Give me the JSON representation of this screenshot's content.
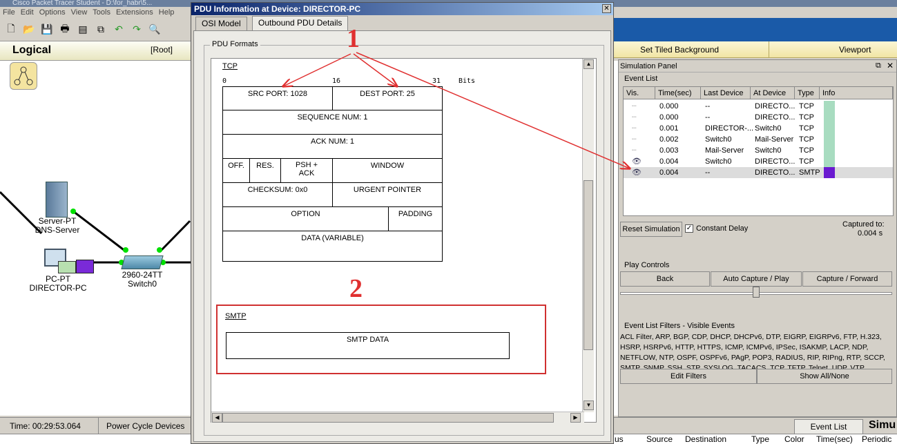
{
  "app": {
    "title": "Cisco Packet Tracer Student - D:\\for_habr\\5...",
    "menu": [
      "File",
      "Edit",
      "Options",
      "View",
      "Tools",
      "Extensions",
      "Help"
    ],
    "logical_label": "Logical",
    "root_label": "[Root]",
    "tiled_label": "Set Tiled Background",
    "viewport_label": "Viewport",
    "time_label": "Time: 00:29:53.064",
    "power_cycle_label": "Power Cycle Devices",
    "event_list_tab": "Event List",
    "simulation_tab": "Simu",
    "bottom_headers": [
      "us",
      "Source",
      "Destination",
      "Type",
      "Color",
      "Time(sec)",
      "Periodic"
    ]
  },
  "devices": {
    "server": {
      "type": "Server-PT",
      "name": "DNS-Server"
    },
    "switch": {
      "type": "2960-24TT",
      "name": "Switch0"
    },
    "pc": {
      "type": "PC-PT",
      "name": "DIRECTOR-PC"
    }
  },
  "dialog": {
    "title": "PDU Information at Device: DIRECTOR-PC",
    "tabs": [
      "OSI Model",
      "Outbound PDU Details"
    ],
    "group_label": "PDU Formats",
    "tcp": {
      "label": "TCP",
      "ruler": [
        "0",
        "16",
        "31",
        "Bits"
      ],
      "src_port": "SRC PORT: 1028",
      "dest_port": "DEST PORT: 25",
      "seq": "SEQUENCE NUM: 1",
      "ack": "ACK NUM: 1",
      "off": "OFF.",
      "res": "RES.",
      "flags": "PSH + ACK",
      "window": "WINDOW",
      "checksum": "CHECKSUM: 0x0",
      "urgent": "URGENT POINTER",
      "option": "OPTION",
      "padding": "PADDING",
      "data": "DATA (VARIABLE)"
    },
    "smtp": {
      "label": "SMTP",
      "data": "SMTP DATA"
    },
    "annotations": {
      "one": "1",
      "two": "2"
    }
  },
  "sim": {
    "title": "Simulation Panel",
    "event_list_label": "Event List",
    "columns": [
      "Vis.",
      "Time(sec)",
      "Last Device",
      "At Device",
      "Type",
      "Info"
    ],
    "events": [
      {
        "time": "0.000",
        "last": "--",
        "at": "DIRECTO...",
        "type": "TCP",
        "color": "#a8dcc0",
        "eye": false,
        "selected": false
      },
      {
        "time": "0.000",
        "last": "--",
        "at": "DIRECTO...",
        "type": "TCP",
        "color": "#a8dcc0",
        "eye": false,
        "selected": false
      },
      {
        "time": "0.001",
        "last": "DIRECTOR-...",
        "at": "Switch0",
        "type": "TCP",
        "color": "#a8dcc0",
        "eye": false,
        "selected": false
      },
      {
        "time": "0.002",
        "last": "Switch0",
        "at": "Mail-Server",
        "type": "TCP",
        "color": "#a8dcc0",
        "eye": false,
        "selected": false
      },
      {
        "time": "0.003",
        "last": "Mail-Server",
        "at": "Switch0",
        "type": "TCP",
        "color": "#a8dcc0",
        "eye": false,
        "selected": false
      },
      {
        "time": "0.004",
        "last": "Switch0",
        "at": "DIRECTO...",
        "type": "TCP",
        "color": "#a8dcc0",
        "eye": true,
        "selected": false
      },
      {
        "time": "0.004",
        "last": "--",
        "at": "DIRECTO...",
        "type": "SMTP",
        "color": "#6a1ad0",
        "eye": true,
        "selected": true
      }
    ],
    "reset_label": "Reset Simulation",
    "constant_delay_label": "Constant Delay",
    "captured_label": "Captured to:",
    "captured_value": "0.004 s",
    "play_controls_label": "Play Controls",
    "back_label": "Back",
    "auto_label": "Auto Capture / Play",
    "capture_label": "Capture / Forward",
    "filters_label": "Event List Filters - Visible Events",
    "filters_text": "ACL Filter, ARP, BGP, CDP, DHCP, DHCPv6, DTP, EIGRP, EIGRPv6, FTP, H.323, HSRP, HSRPv6, HTTP, HTTPS, ICMP, ICMPv6, IPSec, ISAKMP, LACP, NDP, NETFLOW, NTP, OSPF, OSPFv6, PAgP, POP3, RADIUS, RIP, RIPng, RTP, SCCP, SMTP, SNMP, SSH, STP, SYSLOG, TACACS, TCP, TFTP, Telnet, UDP, VTP",
    "edit_filters_label": "Edit Filters",
    "show_all_label": "Show All/None"
  }
}
